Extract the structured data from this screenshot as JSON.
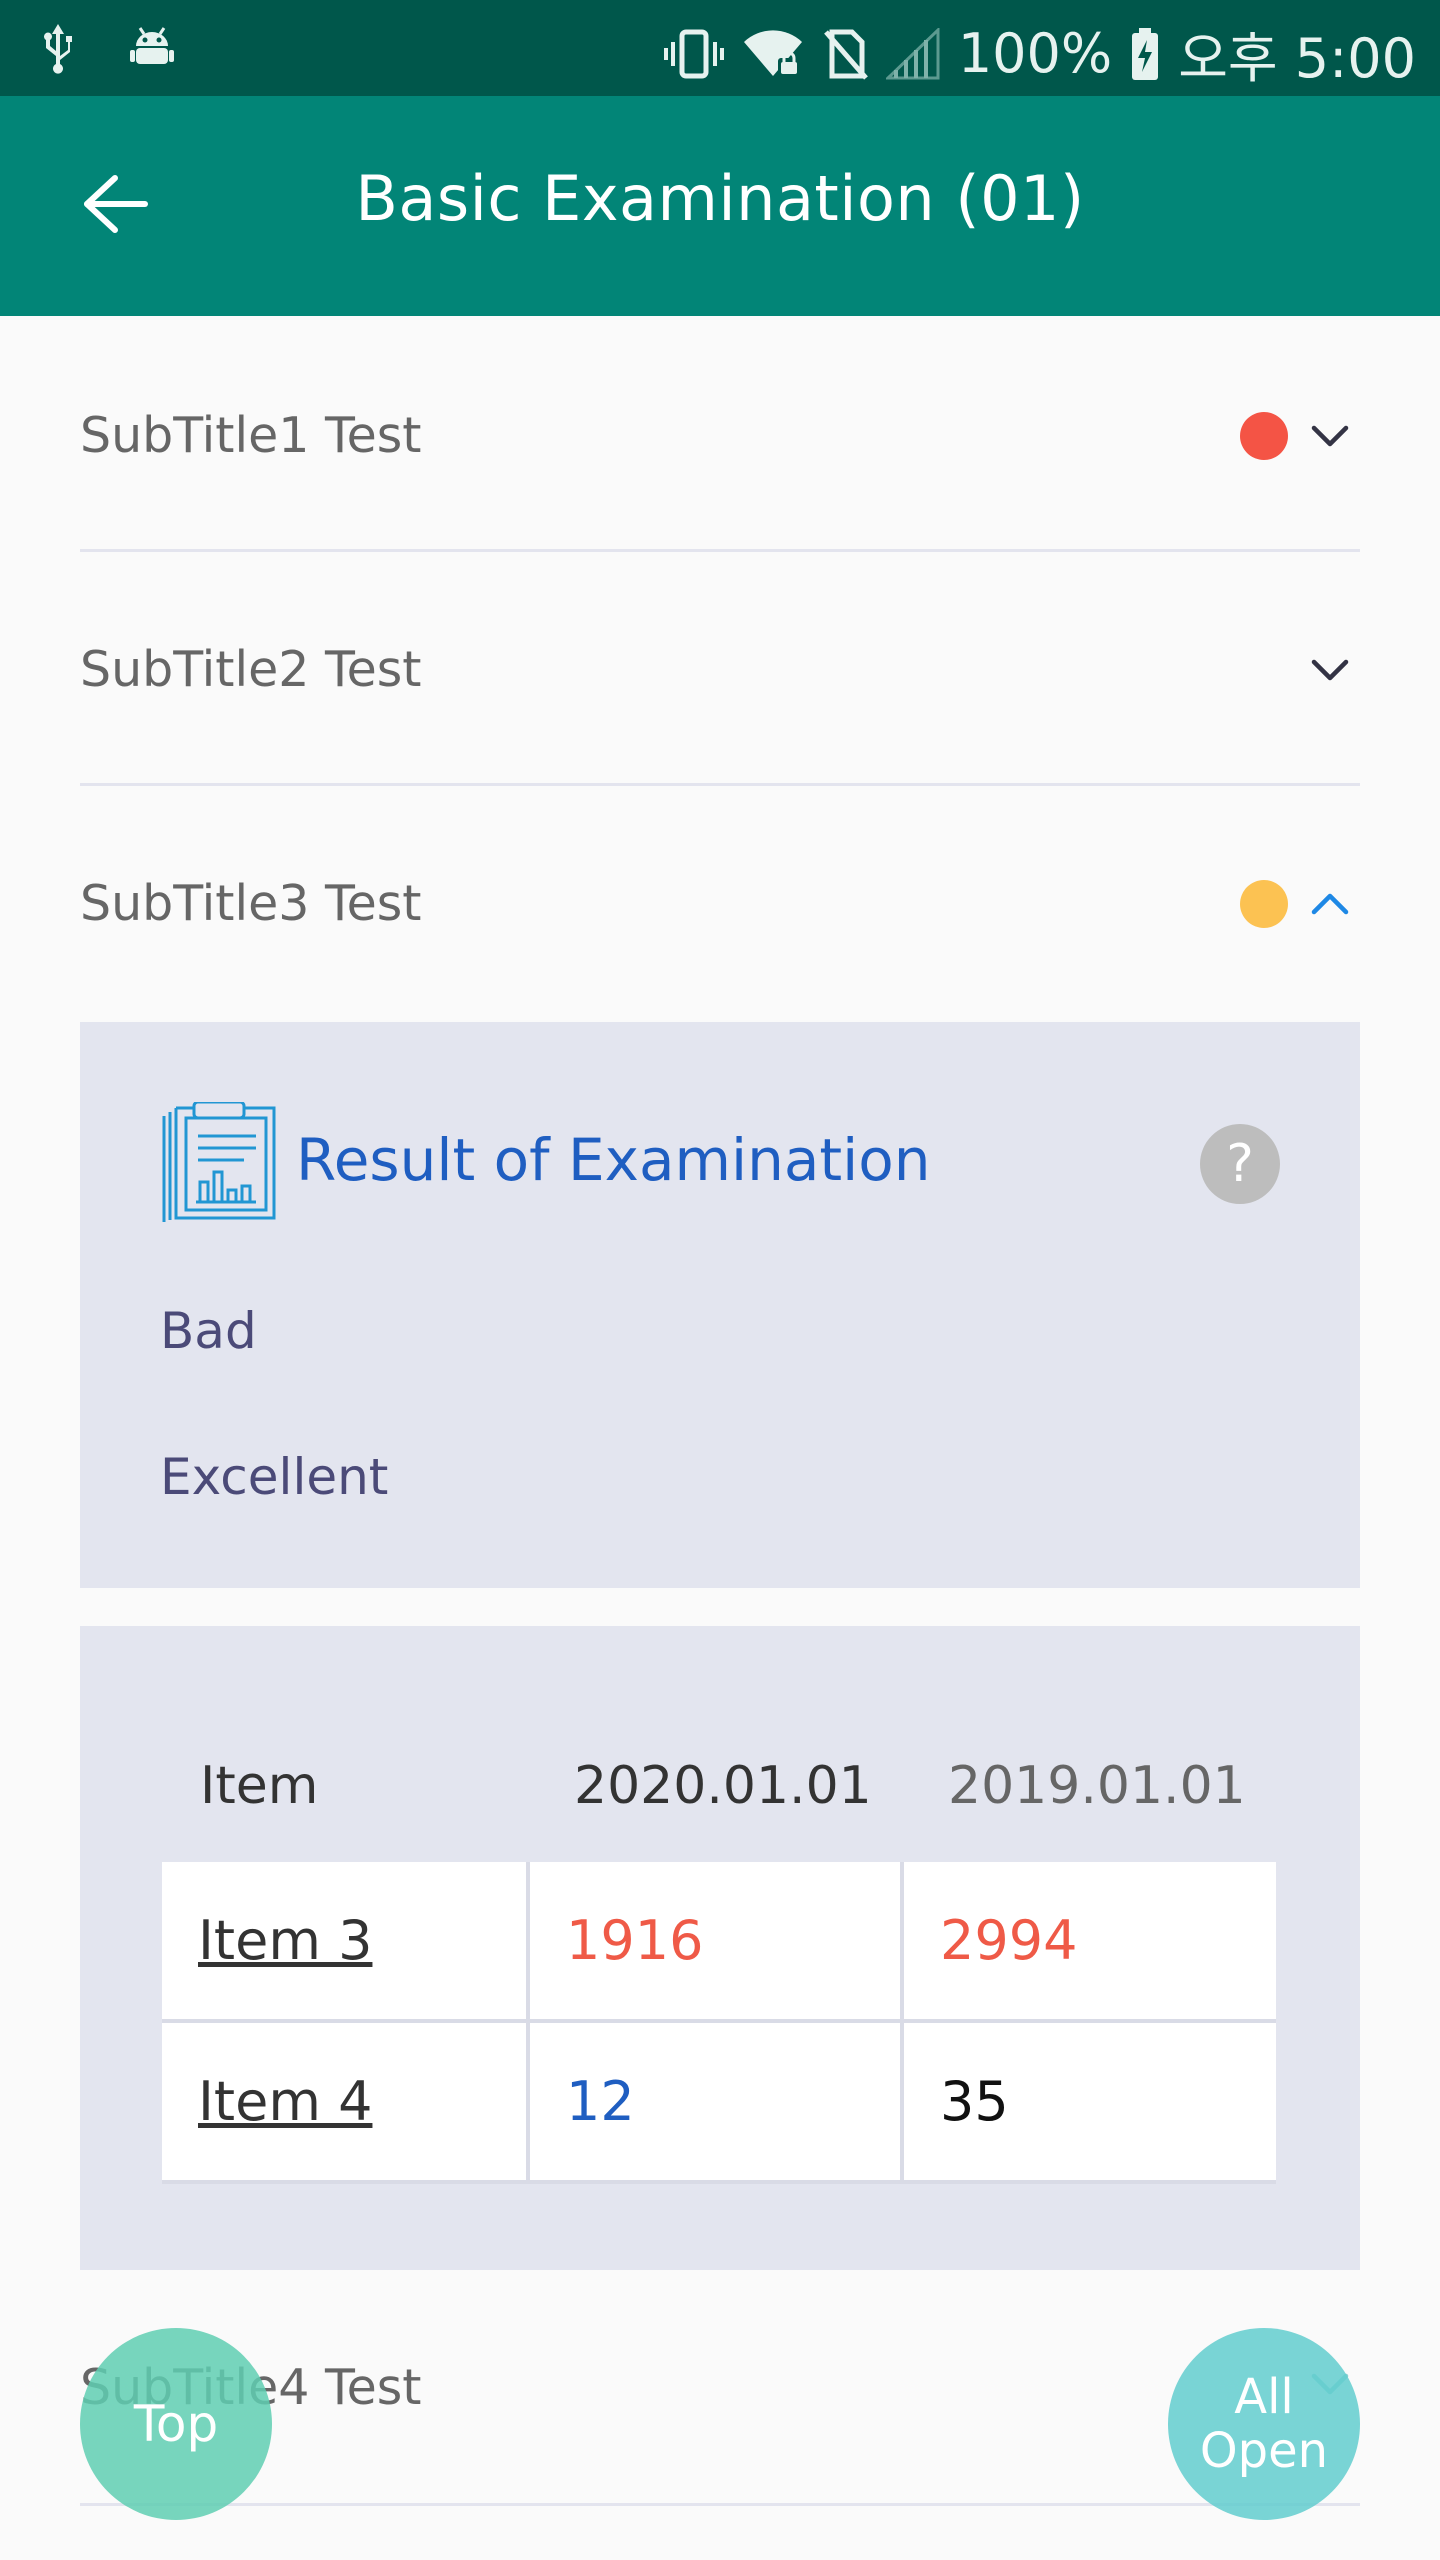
{
  "status_bar": {
    "battery": "100%",
    "time": "오후 5:00",
    "icons": [
      "usb-icon",
      "android-debug-icon",
      "vibrate-icon",
      "wifi-lock-icon",
      "no-sim-icon",
      "signal-icon",
      "battery-charging-icon"
    ]
  },
  "app_bar": {
    "title": "Basic Examination (01)",
    "back_icon": "arrow-left-icon"
  },
  "accordion": [
    {
      "label": "SubTitle1 Test",
      "indicator_color": "#f45445",
      "expanded": false
    },
    {
      "label": "SubTitle2 Test",
      "indicator_color": null,
      "expanded": false
    },
    {
      "label": "SubTitle3 Test",
      "indicator_color": "#fcc252",
      "expanded": true
    },
    {
      "label": "SubTitle4 Test",
      "indicator_color": null,
      "expanded": false
    }
  ],
  "result": {
    "title": "Result of Examination",
    "icon": "clipboard-chart-icon",
    "help_label": "?",
    "lines": [
      "Bad",
      "Excellent"
    ]
  },
  "table": {
    "headers": [
      "Item",
      "2020.01.01",
      "2019.01.01"
    ],
    "rows": [
      {
        "item": "Item 3",
        "v2020": "1916",
        "v2019": "2994",
        "c2020": "#ef5a47",
        "c2019": "#ef5a47"
      },
      {
        "item": "Item 4",
        "v2020": "12",
        "v2019": "35",
        "c2020": "#1f5ec1",
        "c2019": "#111111"
      }
    ]
  },
  "fab": {
    "top_label": "Top",
    "all_open_line1": "All",
    "all_open_line2": "Open"
  },
  "colors": {
    "status_bar": "#00574b",
    "app_bar": "#028577",
    "accent_blue": "#1f5ec1",
    "expanded_chevron": "#1e88e5"
  }
}
